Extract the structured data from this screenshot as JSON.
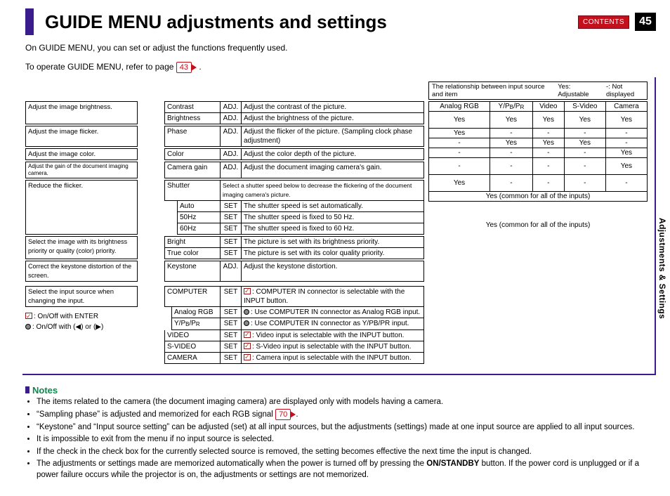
{
  "header": {
    "title": "GUIDE MENU adjustments and settings",
    "contents_btn": "CONTENTS",
    "page_number": "45"
  },
  "intro": {
    "line1": "On GUIDE MENU, you can set or adjust the functions frequently used.",
    "line2_a": "To operate GUIDE MENU, refer to page ",
    "line2_ref": "43",
    "line2_b": "."
  },
  "side_tab": "Adjustments & Settings",
  "caption": {
    "a": "The relationship between input source and item",
    "b": "Yes: Adjustable",
    "c": "-: Not displayed"
  },
  "matrix": {
    "headers": [
      "Analog RGB",
      "Y/PB/PR",
      "Video",
      "S-Video",
      "Camera"
    ],
    "rows": [
      [
        "Yes",
        "Yes",
        "Yes",
        "Yes",
        "Yes"
      ],
      [
        "Yes",
        "-",
        "-",
        "-",
        "-"
      ],
      [
        "-",
        "Yes",
        "Yes",
        "Yes",
        "-"
      ],
      [
        "-",
        "-",
        "-",
        "-",
        "Yes"
      ],
      [
        "-",
        "-",
        "-",
        "-",
        "Yes"
      ],
      [
        "Yes",
        "-",
        "-",
        "-",
        "-"
      ]
    ],
    "common1": "Yes (common for all of the inputs)",
    "common2": "Yes (common for all of the inputs)"
  },
  "left_notes": {
    "brightness": "Adjust the image brightness.",
    "flicker": "Adjust the image flicker.",
    "color": "Adjust the image color.",
    "gain": "Adjust the gain of the document imaging camera.",
    "reduce": "Reduce the flicker.",
    "priority": "Select the image with its brightness priority or quality (color) priority.",
    "keystone": "Correct the keystone distortion of the screen.",
    "input": "Select the input source when changing the input.",
    "legend_check": ": On/Off with ENTER",
    "legend_dot": ": On/Off with (◀) or (▶)"
  },
  "items": {
    "contrast": {
      "name": "Contrast",
      "mode": "ADJ.",
      "desc": "Adjust the contrast of the picture."
    },
    "brightness": {
      "name": "Brightness",
      "mode": "ADJ.",
      "desc": "Adjust the brightness of the picture."
    },
    "phase": {
      "name": "Phase",
      "mode": "ADJ.",
      "desc": "Adjust the flicker of the picture. (Sampling clock phase adjustment)"
    },
    "colorI": {
      "name": "Color",
      "mode": "ADJ.",
      "desc": "Adjust the color depth of the picture."
    },
    "cgain": {
      "name": "Camera gain",
      "mode": "ADJ.",
      "desc": "Adjust the document imaging camera's gain."
    },
    "shutter": {
      "name": "Shutter",
      "desc": "Select a shutter speed below to decrease the flickering of the document imaging camera's picture."
    },
    "sh_auto": {
      "name": "Auto",
      "mode": "SET",
      "desc": "The shutter speed is set automatically."
    },
    "sh_50": {
      "name": "50Hz",
      "mode": "SET",
      "desc": "The shutter speed is fixed to 50 Hz."
    },
    "sh_60": {
      "name": "60Hz",
      "mode": "SET",
      "desc": "The shutter speed is fixed to 60 Hz."
    },
    "bright": {
      "name": "Bright",
      "mode": "SET",
      "desc": "The picture is set with its brightness priority."
    },
    "truec": {
      "name": "True color",
      "mode": "SET",
      "desc": "The picture is set with its color quality priority."
    },
    "keystone": {
      "name": "Keystone",
      "mode": "ADJ.",
      "desc": "Adjust the keystone distortion."
    },
    "comp": {
      "name": "COMPUTER",
      "mode": "SET",
      "desc": ": COMPUTER IN connector is selectable with the INPUT button."
    },
    "argb": {
      "name": "Analog RGB",
      "mode": "SET",
      "desc": ": Use COMPUTER IN connector as Analog RGB input."
    },
    "ypbpr": {
      "name": "Y/PB/PR",
      "mode": "SET",
      "desc": ": Use COMPUTER IN connector as Y/PB/PR input."
    },
    "video": {
      "name": "VIDEO",
      "mode": "SET",
      "desc": ": Video input is selectable with the INPUT button."
    },
    "svideo": {
      "name": "S-VIDEO",
      "mode": "SET",
      "desc": ": S-Video input is selectable with the INPUT button."
    },
    "camera": {
      "name": "CAMERA",
      "mode": "SET",
      "desc": ": Camera input is selectable with the INPUT button."
    }
  },
  "notes": {
    "heading": "Notes",
    "n1": "The items related to the camera (the document imaging camera) are displayed only with models having a camera.",
    "n2a": "“Sampling phase” is adjusted and memorized for each RGB signal ",
    "n2ref": "70",
    "n2b": ".",
    "n3": "“Keystone” and “Input source setting” can be adjusted (set) at all input sources, but the adjustments (settings) made at one input source are applied to all input sources.",
    "n4": "It is impossible to exit from the menu if no input source is selected.",
    "n5": "If the check in the check box for the currently selected source is removed, the setting becomes effective the next time the input is changed.",
    "n6": "The adjustments or settings made are memorized automatically when the power is turned off by pressing the ON/STANDBY button. If the power cord is unplugged or if a power failure occurs while the projector is on, the adjustments or settings are not memorized."
  }
}
